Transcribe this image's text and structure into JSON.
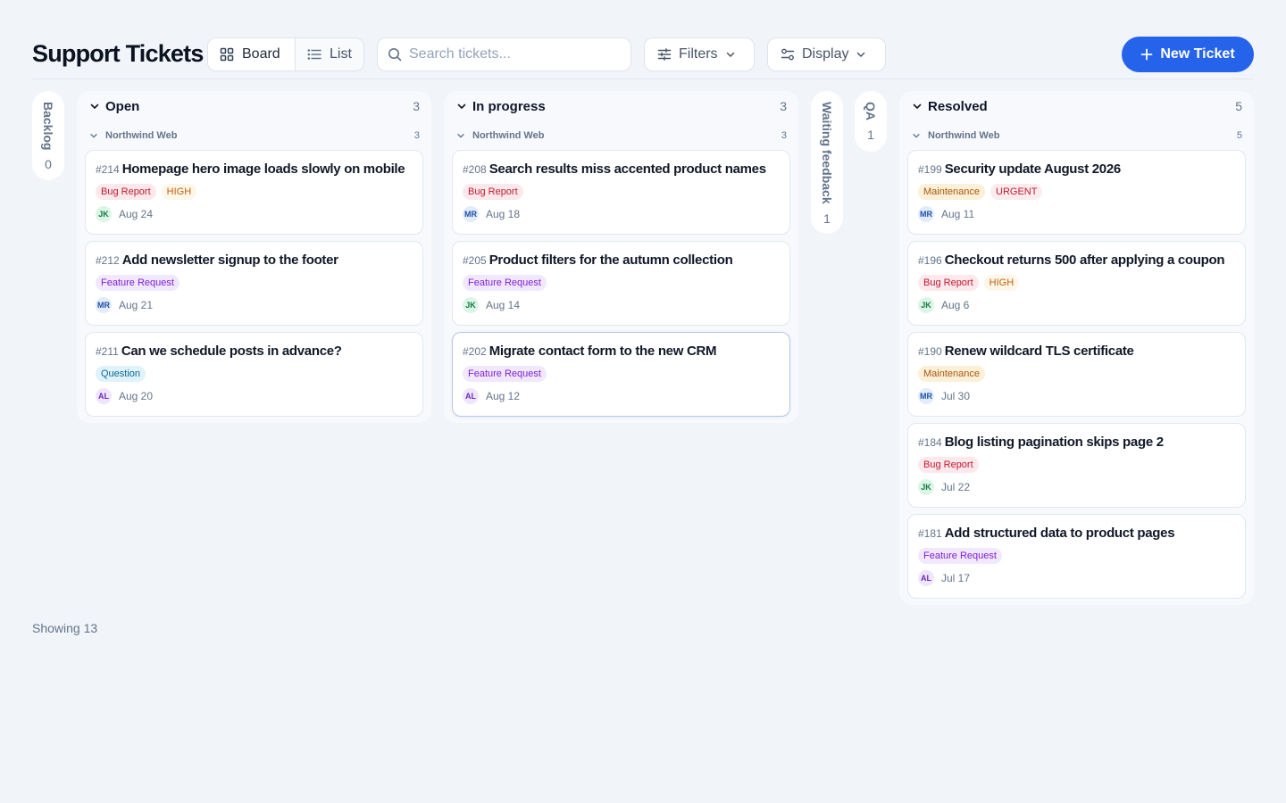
{
  "header": {
    "title": "Support Tickets",
    "views": {
      "board_label": "Board",
      "list_label": "List"
    },
    "search_placeholder": "Search tickets...",
    "filters_label": "Filters",
    "display_label": "Display",
    "new_ticket_label": "New Ticket",
    "accent_color": "#2563eb"
  },
  "collapsed": {
    "backlog": {
      "label": "Backlog",
      "count": "0"
    },
    "waiting": {
      "label": "Waiting feedback",
      "count": "1"
    },
    "qa": {
      "label": "QA",
      "count": "1"
    }
  },
  "columns": {
    "open": {
      "title": "Open",
      "count": "3",
      "group": {
        "name": "Northwind Web",
        "count": "3"
      },
      "cards": [
        {
          "num": "#214",
          "title": "Homepage hero image loads slowly on mobile",
          "type": "Bug Report",
          "priority": "HIGH",
          "avatar": "JK",
          "date": "Aug 24"
        },
        {
          "num": "#212",
          "title": "Add newsletter signup to the footer",
          "type": "Feature Request",
          "avatar": "MR",
          "date": "Aug 21"
        },
        {
          "num": "#211",
          "title": "Can we schedule posts in advance?",
          "type": "Question",
          "avatar": "AL",
          "date": "Aug 20"
        }
      ]
    },
    "inprogress": {
      "title": "In progress",
      "count": "3",
      "group": {
        "name": "Northwind Web",
        "count": "3"
      },
      "cards": [
        {
          "num": "#208",
          "title": "Search results miss accented product names",
          "type": "Bug Report",
          "avatar": "MR",
          "date": "Aug 18"
        },
        {
          "num": "#205",
          "title": "Product filters for the autumn collection",
          "type": "Feature Request",
          "avatar": "JK",
          "date": "Aug 14"
        },
        {
          "num": "#202",
          "title": "Migrate contact form to the new CRM",
          "type": "Feature Request",
          "avatar": "AL",
          "date": "Aug 12"
        }
      ]
    },
    "resolved": {
      "title": "Resolved",
      "count": "5",
      "group": {
        "name": "Northwind Web",
        "count": "5"
      },
      "cards": [
        {
          "num": "#199",
          "title": "Security update August 2026",
          "type": "Maintenance",
          "priority": "URGENT",
          "avatar": "MR",
          "date": "Aug 11"
        },
        {
          "num": "#196",
          "title": "Checkout returns 500 after applying a coupon",
          "type": "Bug Report",
          "priority": "HIGH",
          "avatar": "JK",
          "date": "Aug 6"
        },
        {
          "num": "#190",
          "title": "Renew wildcard TLS certificate",
          "type": "Maintenance",
          "avatar": "MR",
          "date": "Jul 30"
        },
        {
          "num": "#184",
          "title": "Blog listing pagination skips page 2",
          "type": "Bug Report",
          "avatar": "JK",
          "date": "Jul 22"
        },
        {
          "num": "#181",
          "title": "Add structured data to product pages",
          "type": "Feature Request",
          "avatar": "AL",
          "date": "Jul 17"
        }
      ]
    }
  },
  "footer": {
    "showing": "Showing 13"
  }
}
